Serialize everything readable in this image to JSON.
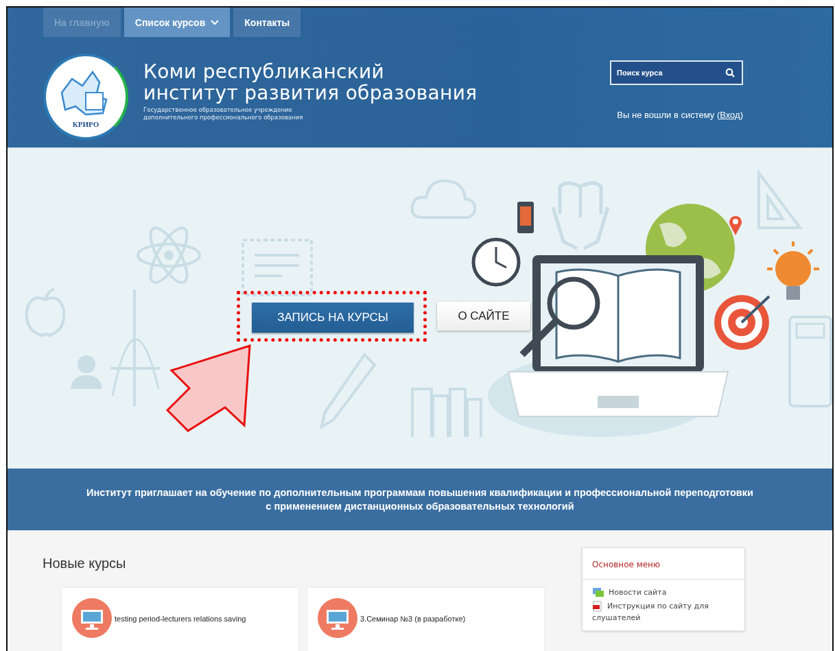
{
  "nav": {
    "items": [
      {
        "label": "На главную",
        "selected": false,
        "disabled": true,
        "has_menu": false
      },
      {
        "label": "Список курсов",
        "selected": true,
        "disabled": false,
        "has_menu": true
      },
      {
        "label": "Контакты",
        "selected": false,
        "disabled": false,
        "has_menu": false
      }
    ]
  },
  "header": {
    "logo_text": "КРИРО",
    "title_lines": [
      "Коми республиканский",
      "институт развития образования"
    ],
    "subtitle_lines": [
      "Государственное образовательное учреждение",
      "дополнительного профессионального образования"
    ],
    "search": {
      "placeholder": "Поиск курса"
    },
    "login": {
      "text": "Вы не вошли в систему (",
      "link": "Вход",
      "after": ")"
    }
  },
  "hero": {
    "buttons": [
      {
        "label": "ЗАПИСЬ НА КУРСЫ",
        "kind": "primary",
        "highlighted": true
      },
      {
        "label": "О САЙТЕ",
        "kind": "secondary",
        "highlighted": false
      }
    ]
  },
  "banner": {
    "lines": [
      "Институт приглашает на обучение по дополнительным программам повышения квалификации и профессиональной переподготовки",
      "с применением дистанционных образовательных технологий"
    ]
  },
  "new_courses": {
    "title": "Новые курсы",
    "cards": [
      {
        "title": "testing period-lecturers relations saving"
      },
      {
        "title": "3.Семинар №3 (в разработке)"
      }
    ]
  },
  "main_menu": {
    "title": "Основное меню",
    "items": [
      {
        "label": "Новости сайта",
        "kind": "news"
      },
      {
        "label": "Инструкция по сайту для слушателей",
        "kind": "pdf"
      }
    ]
  }
}
